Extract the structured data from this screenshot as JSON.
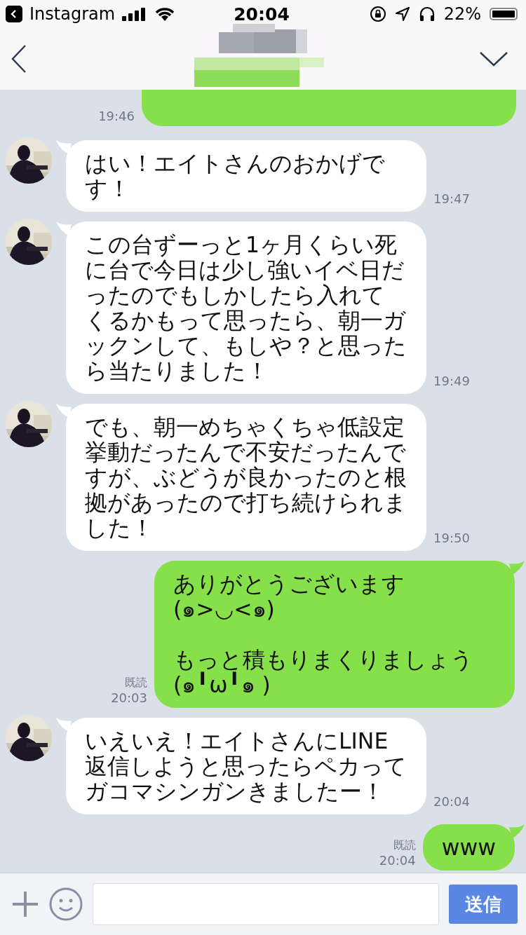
{
  "status_bar": {
    "back_app": "Instagram",
    "time": "20:04",
    "battery": "22%"
  },
  "header": {
    "title_redacted": true
  },
  "messages": [
    {
      "kind": "sent",
      "partial": true,
      "time": "19:46"
    },
    {
      "kind": "received",
      "text": "はい！エイトさんのおかげです！",
      "time": "19:47"
    },
    {
      "kind": "received",
      "text": "この台ずーっと1ヶ月くらい死に台で今日は少し強いイベ日だったのでもしかしたら入れてくるかもって思ったら、朝一ガックンして、もしや？と思ったら当たりました！",
      "time": "19:49"
    },
    {
      "kind": "received",
      "text": "でも、朝一めちゃくちゃ低設定挙動だったんで不安だったんですが、ぶどうが良かったのと根拠があったので打ち続けられました！",
      "time": "19:50"
    },
    {
      "kind": "sent",
      "text": "ありがとうございます(๑>◡<๑)\n\nもっと積もりまくりましょう(๑╹ω╹๑ )",
      "read": "既読",
      "time": "20:03"
    },
    {
      "kind": "received",
      "text": "いえいえ！エイトさんにLINE返信しようと思ったらペカってガコマシンガンきましたー！",
      "time": "20:04"
    },
    {
      "kind": "sent",
      "text": "www",
      "read": "既読",
      "time": "20:04"
    }
  ],
  "composer": {
    "send_button": "送信"
  }
}
